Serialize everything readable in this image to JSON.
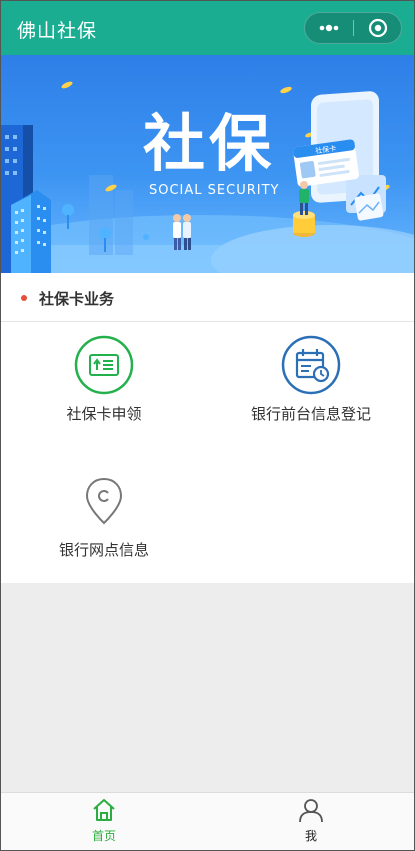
{
  "app": {
    "title": "佛山社保"
  },
  "capsule": {
    "more_icon": "more-dots-icon",
    "close_icon": "mini-program-close-icon"
  },
  "banner": {
    "title": "社保",
    "subtitle": "SOCIAL SECURITY",
    "card_text": "社保卡"
  },
  "section": {
    "title": "社保卡业务"
  },
  "services": [
    {
      "label": "社保卡申领",
      "icon": "card-upload-icon",
      "color": "#22b14c"
    },
    {
      "label": "银行前台信息登记",
      "icon": "calendar-clock-icon",
      "color": "#2b6fb6"
    },
    {
      "label": "银行网点信息",
      "icon": "location-pin-icon",
      "color": "#777777"
    }
  ],
  "tabbar": {
    "tabs": [
      {
        "label": "首页",
        "icon": "home-icon",
        "active": true
      },
      {
        "label": "我",
        "icon": "user-icon",
        "active": false
      }
    ],
    "active_color": "#2aae3f",
    "inactive_color": "#333333"
  },
  "colors": {
    "titlebar": "#1aad92",
    "banner": "#3d95f2",
    "accent_dot": "#e74c3c"
  }
}
